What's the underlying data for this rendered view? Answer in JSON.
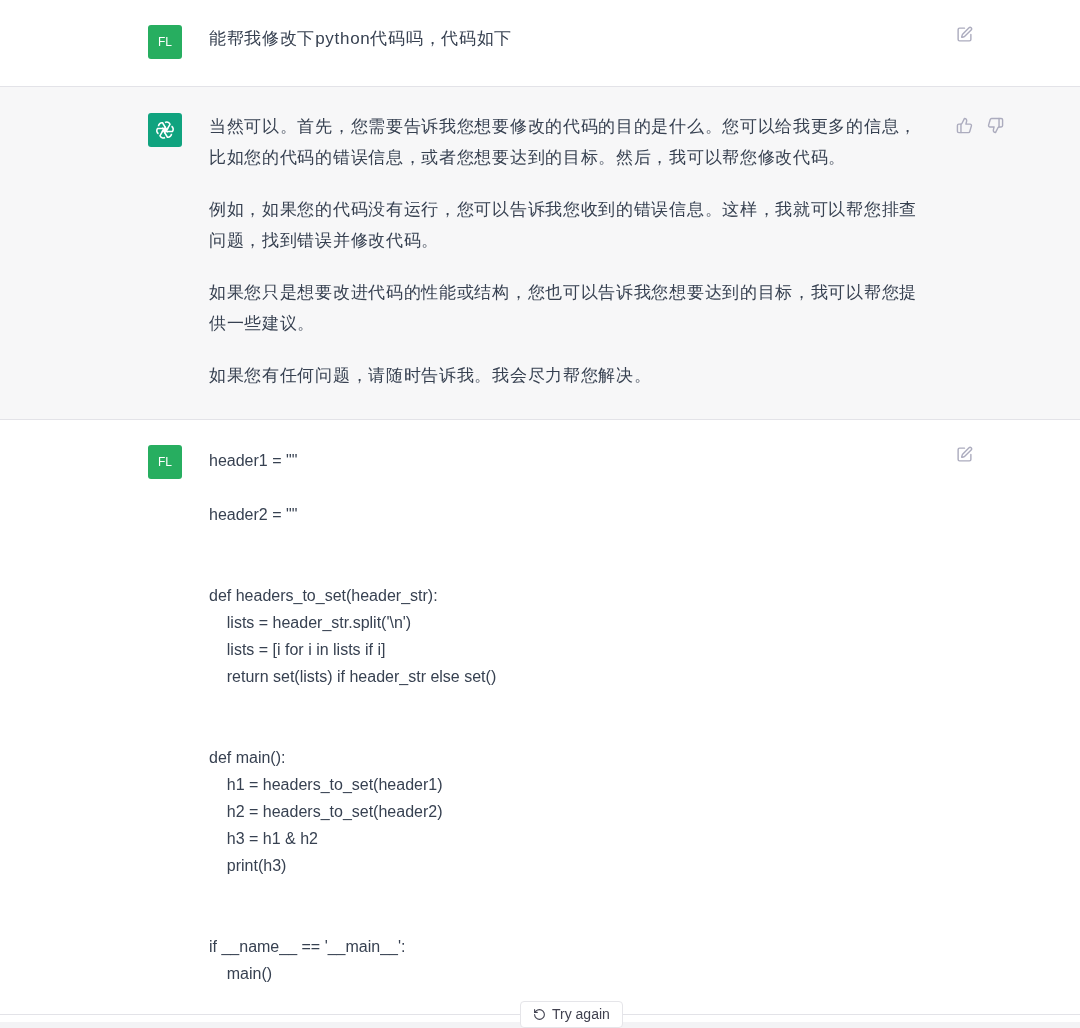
{
  "messages": [
    {
      "kind": "user",
      "avatar": "FL",
      "paragraphs": [
        "能帮我修改下python代码吗，代码如下"
      ]
    },
    {
      "kind": "assistant",
      "paragraphs": [
        "当然可以。首先，您需要告诉我您想要修改的代码的目的是什么。您可以给我更多的信息，比如您的代码的错误信息，或者您想要达到的目标。然后，我可以帮您修改代码。",
        "例如，如果您的代码没有运行，您可以告诉我您收到的错误信息。这样，我就可以帮您排查问题，找到错误并修改代码。",
        "如果您只是想要改进代码的性能或结构，您也可以告诉我您想要达到的目标，我可以帮您提供一些建议。",
        "如果您有任何问题，请随时告诉我。我会尽力帮您解决。"
      ]
    },
    {
      "kind": "user",
      "avatar": "FL",
      "code": "header1 = \"\"\n\nheader2 = \"\"\n\n\ndef headers_to_set(header_str):\n    lists = header_str.split('\\n')\n    lists = [i for i in lists if i]\n    return set(lists) if header_str else set()\n\n\ndef main():\n    h1 = headers_to_set(header1)\n    h2 = headers_to_set(header2)\n    h3 = h1 & h2\n    print(h3)\n\n\nif __name__ == '__main__':\n    main()"
    }
  ],
  "try_again_button": {
    "label": "Try again"
  }
}
